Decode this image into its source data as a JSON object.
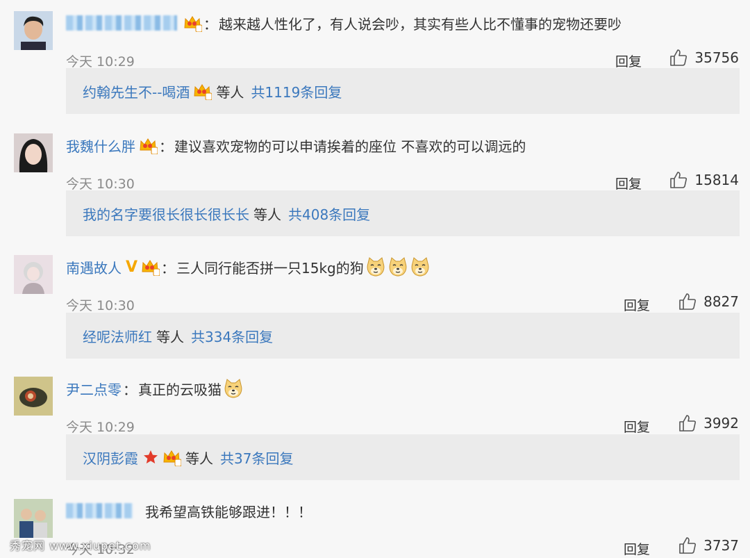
{
  "colors": {
    "link": "#3b78bd",
    "background": "#f7f7f7",
    "reply_box": "#ebebeb",
    "vip_crown": "#f5a700"
  },
  "comments": [
    {
      "username": "",
      "username_obscured": true,
      "badges": [
        "vip-crown-icon"
      ],
      "separator": "：",
      "text": "越来越人性化了，有人说会吵，其实有些人比不懂事的宠物还要吵",
      "time": "今天 10:29",
      "reply_label": "回复",
      "likes": "35756",
      "replies": {
        "first_user": "约翰先生不--喝酒",
        "etc": "等人",
        "count_text": "共1119条回复"
      }
    },
    {
      "username": "我魏什么胖",
      "badges": [
        "vip-crown-icon"
      ],
      "separator": "：",
      "text": "建议喜欢宠物的可以申请挨着的座位 不喜欢的可以调远的",
      "time": "今天 10:30",
      "reply_label": "回复",
      "likes": "15814",
      "replies": {
        "first_user": "我的名字要很长很长很长长",
        "etc": "等人",
        "count_text": "共408条回复"
      }
    },
    {
      "username": "南遇故人",
      "badges": [
        "verified-v-icon",
        "vip-crown-icon"
      ],
      "separator": "：",
      "text": "三人同行能否拼一只15kg的狗",
      "emojis": [
        "doge-emoji",
        "doge-emoji",
        "doge-emoji"
      ],
      "time": "今天 10:30",
      "reply_label": "回复",
      "likes": "8827",
      "replies": {
        "first_user": "经呢法师红",
        "etc": "等人",
        "count_text": "共334条回复"
      }
    },
    {
      "username": "尹二点零",
      "badges": [],
      "separator": "：",
      "text": "真正的云吸猫",
      "emojis": [
        "doge-emoji"
      ],
      "time": "今天 10:29",
      "reply_label": "回复",
      "likes": "3992",
      "replies": {
        "first_user": "汉阴彭霞",
        "badges": [
          "star-icon",
          "vip-crown-icon"
        ],
        "etc": "等人",
        "count_text": "共37条回复"
      }
    },
    {
      "username": "",
      "username_obscured": true,
      "badges": [],
      "separator": "",
      "text": "我希望高铁能够跟进！！！",
      "time": "今天 10:32",
      "reply_label": "回复",
      "likes": "3737"
    }
  ],
  "watermark": "秀宠网 www.xiupet.com"
}
